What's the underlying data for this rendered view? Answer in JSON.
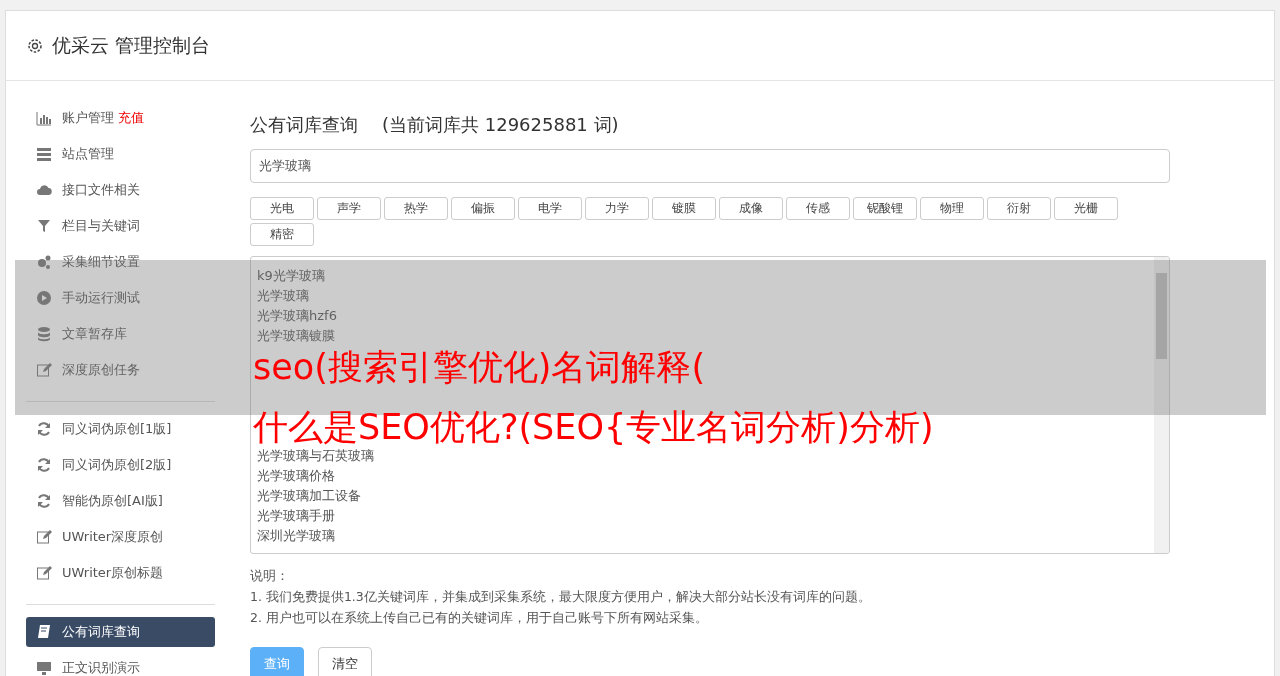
{
  "header": {
    "title": "优采云 管理控制台"
  },
  "sidebar": {
    "groups": [
      [
        {
          "label": "账户管理",
          "badge": "充值",
          "kind": "chart",
          "selected": false
        },
        {
          "label": "站点管理",
          "kind": "server",
          "selected": false
        },
        {
          "label": "接口文件相关",
          "kind": "cloud",
          "selected": false
        },
        {
          "label": "栏目与关键词",
          "kind": "filter",
          "selected": false
        },
        {
          "label": "采集细节设置",
          "kind": "gears",
          "selected": false
        },
        {
          "label": "手动运行测试",
          "kind": "play",
          "selected": false
        },
        {
          "label": "文章暂存库",
          "kind": "database",
          "selected": false
        },
        {
          "label": "深度原创任务",
          "kind": "edit",
          "selected": false
        }
      ],
      [
        {
          "label": "同义词伪原创[1版]",
          "kind": "refresh",
          "selected": false
        },
        {
          "label": "同义词伪原创[2版]",
          "kind": "refresh",
          "selected": false
        },
        {
          "label": "智能伪原创[AI版]",
          "kind": "refresh",
          "selected": false
        },
        {
          "label": "UWriter深度原创",
          "kind": "edit",
          "selected": false
        },
        {
          "label": "UWriter原创标题",
          "kind": "edit",
          "selected": false
        }
      ],
      [
        {
          "label": "公有词库查询",
          "kind": "book",
          "selected": true
        },
        {
          "label": "正文识别演示",
          "kind": "monitor",
          "selected": false
        }
      ]
    ]
  },
  "main": {
    "title": "公有词库查询",
    "count_note": "(当前词库共 129625881 词)",
    "search": {
      "value": "光学玻璃"
    },
    "tags": [
      "光电",
      "声学",
      "热学",
      "偏振",
      "电学",
      "力学",
      "镀膜",
      "成像",
      "传感",
      "铌酸锂",
      "物理",
      "衍射",
      "光栅",
      "精密"
    ],
    "results": [
      "k9光学玻璃",
      "光学玻璃",
      "光学玻璃hzf6",
      "光学玻璃镀膜",
      "光学玻璃与石英玻璃",
      "光学玻璃价格",
      "光学玻璃加工设备",
      "光学玻璃手册",
      "深圳光学玻璃"
    ],
    "notes_title": "说明：",
    "notes": [
      "1. 我们免费提供1.3亿关键词库，并集成到采集系统，最大限度方便用户，解决大部分站长没有词库的问题。",
      "2. 用户也可以在系统上传自己已有的关键词库，用于自己账号下所有网站采集。"
    ],
    "buttons": [
      {
        "label": "查询",
        "kind": "primary"
      },
      {
        "label": "清空",
        "kind": "default"
      }
    ]
  },
  "overlay": {
    "lines": [
      "seo(搜索引擎优化)名词解释(",
      "什么是SEO优化?(SEO{专业名词分析)分析)"
    ]
  }
}
